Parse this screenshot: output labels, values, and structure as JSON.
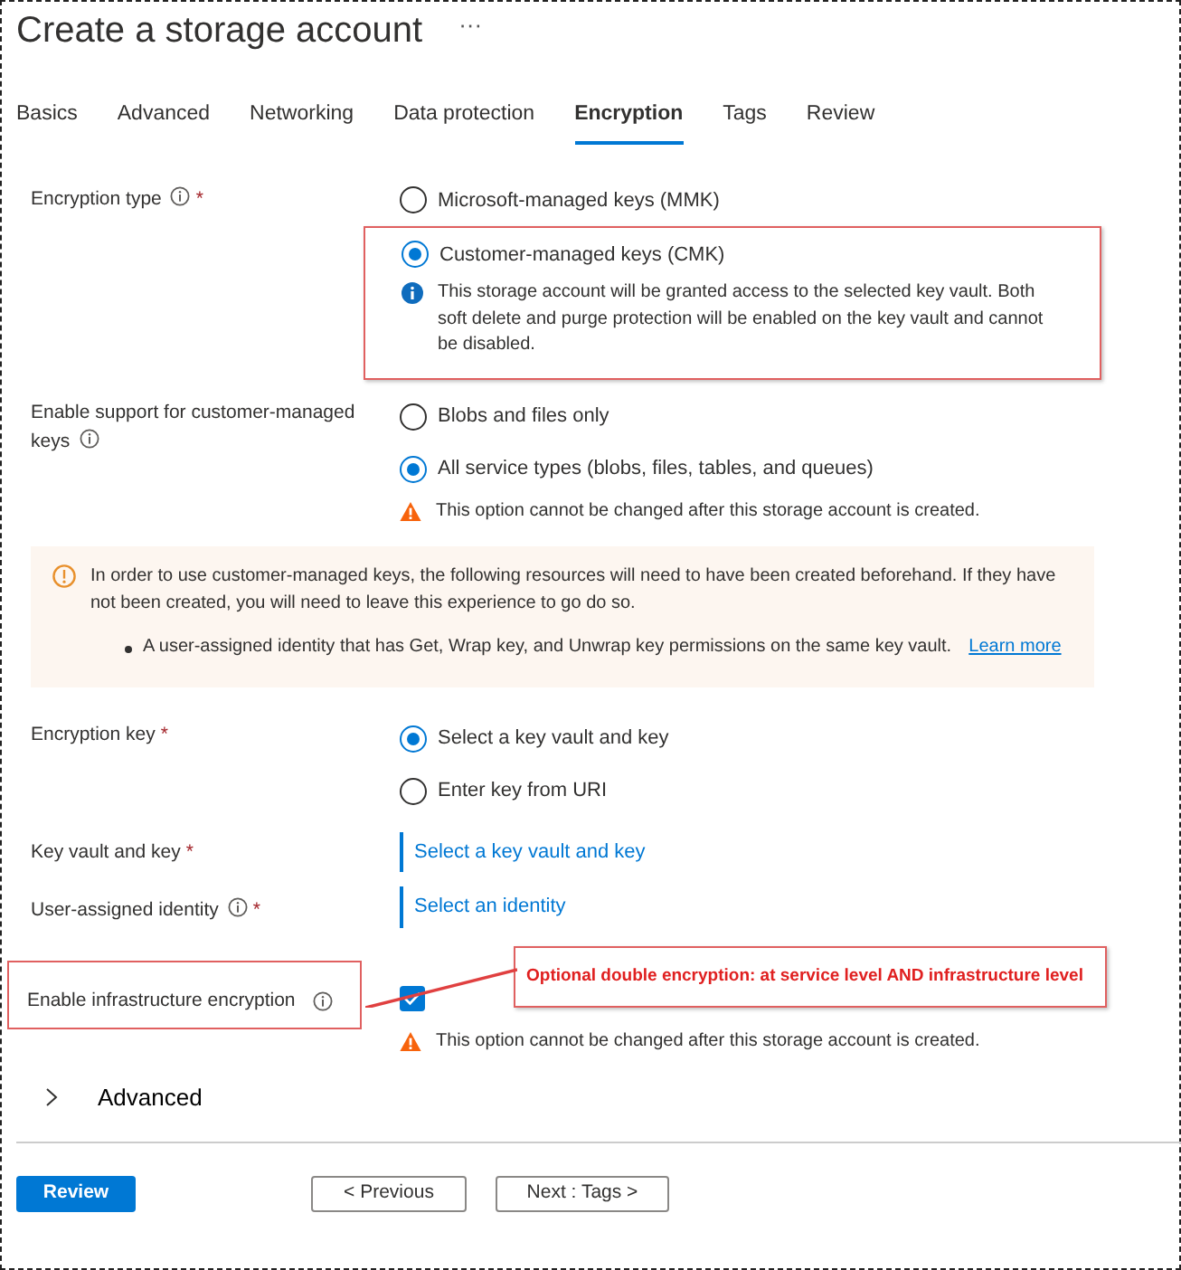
{
  "title": "Create a storage account",
  "more": "···",
  "tabs": [
    {
      "label": "Basics",
      "selected": false
    },
    {
      "label": "Advanced",
      "selected": false
    },
    {
      "label": "Networking",
      "selected": false
    },
    {
      "label": "Data protection",
      "selected": false
    },
    {
      "label": "Encryption",
      "selected": true
    },
    {
      "label": "Tags",
      "selected": false
    },
    {
      "label": "Review",
      "selected": false
    }
  ],
  "fields": [
    {
      "kind": "radio",
      "label": "Encryption type",
      "info": true,
      "required_mark": "*",
      "options": [
        {
          "label": "Microsoft-managed keys (MMK)",
          "selected": false,
          "highlighted": false
        },
        {
          "label": "Customer-managed keys (CMK)",
          "selected": true,
          "highlighted": true,
          "note": {
            "kind": "info",
            "text": "This storage account will be granted access to the selected key vault. Both soft delete and purge protection will be enabled on the key vault and cannot be disabled."
          }
        }
      ]
    },
    {
      "kind": "radio",
      "label": "Enable support for customer-managed keys",
      "info": true,
      "options": [
        {
          "label": "Blobs and files only",
          "selected": false,
          "highlighted": false
        },
        {
          "label": "All service types (blobs, files, tables, and queues)",
          "selected": true,
          "highlighted": false
        }
      ],
      "note": {
        "kind": "warning",
        "text": "This option cannot be changed after this storage account is created."
      }
    },
    {
      "kind": "notice",
      "text": "In order to use customer-managed keys, the following resources will need to have been created beforehand. If they have not been created, you will need to leave this experience to go do so.",
      "bullet": "A user-assigned identity that has Get, Wrap key, and Unwrap key permissions on the same key vault.",
      "link": "Learn more"
    },
    {
      "kind": "radio",
      "label": "Encryption key",
      "info": false,
      "required_mark": "*",
      "options": [
        {
          "label": "Select a key vault and key",
          "selected": true,
          "highlighted": false
        },
        {
          "label": "Enter key from URI",
          "selected": false,
          "highlighted": false
        }
      ]
    },
    {
      "kind": "link",
      "label": "Key vault and key",
      "info": false,
      "required_mark": "*",
      "value": "Select a key vault and key"
    },
    {
      "kind": "link",
      "label": "User-assigned identity",
      "info": true,
      "required_mark": "*",
      "value": "Select an identity"
    },
    {
      "kind": "checkbox",
      "label": "Enable infrastructure encryption",
      "info": true,
      "checked": true,
      "highlighted": true,
      "annotation": "Optional double encryption: at service level AND infrastructure level",
      "note": {
        "kind": "warning",
        "text": "This option cannot be changed after this storage account is created."
      }
    }
  ],
  "advanced": {
    "label": "Advanced",
    "expanded": false
  },
  "buttons": [
    {
      "label": "Review",
      "kind": "primary"
    },
    {
      "label": "< Previous",
      "kind": "secondary"
    },
    {
      "label": "Next : Tags >",
      "kind": "secondary"
    }
  ]
}
